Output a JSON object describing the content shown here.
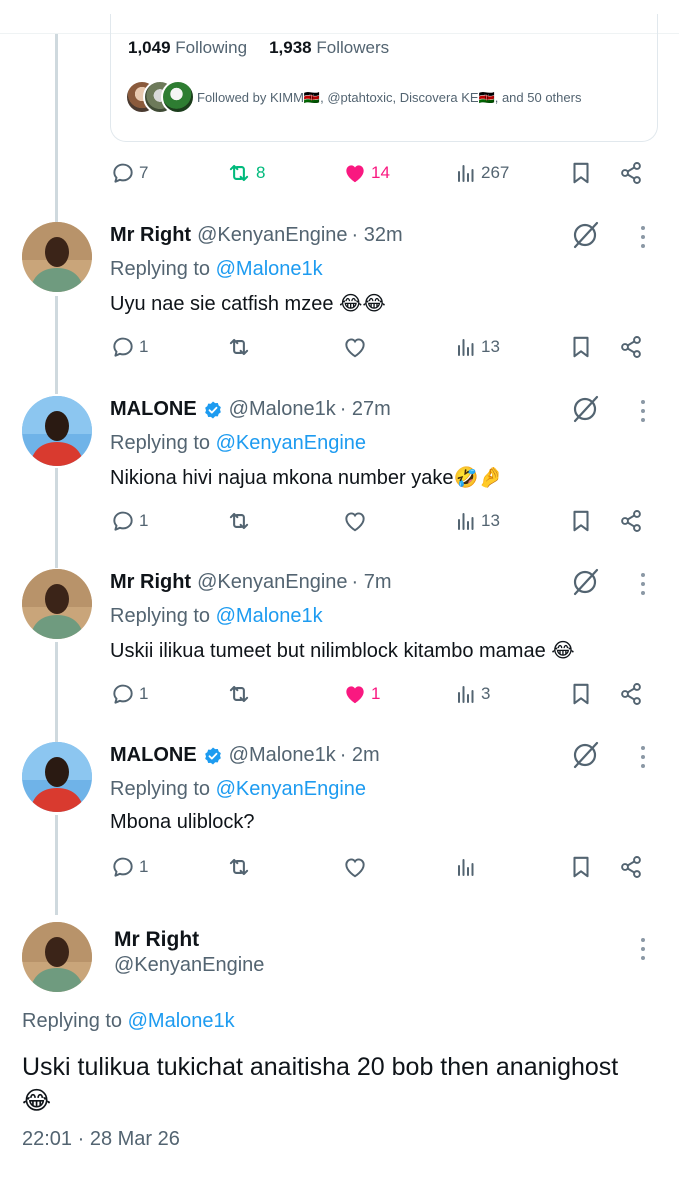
{
  "profile_card": {
    "following_count": "1,049",
    "following_label": "Following",
    "followers_count": "1,938",
    "followers_label": "Followers",
    "followed_by": "Followed by KIMM🇰🇪, @ptahtoxic, Discovera KE🇰🇪, and 50 others"
  },
  "original_actions": {
    "replies": "7",
    "reposts": "8",
    "likes": "14",
    "views": "267"
  },
  "replies": [
    {
      "name": "Mr Right",
      "verified": false,
      "handle": "@KenyanEngine",
      "time": "· 32m",
      "replying_prefix": "Replying to",
      "replying_to": "@Malone1k",
      "text": "Uyu nae sie catfish mzee 😂😂",
      "replies": "1",
      "reposts": "",
      "likes": "",
      "views": "13",
      "liked": false
    },
    {
      "name": "MALONE",
      "verified": true,
      "handle": "@Malone1k",
      "time": "· 27m",
      "replying_prefix": "Replying to",
      "replying_to": "@KenyanEngine",
      "text": "Nikiona hivi najua mkona number yake🤣🤌",
      "replies": "1",
      "reposts": "",
      "likes": "",
      "views": "13",
      "liked": false
    },
    {
      "name": "Mr Right",
      "verified": false,
      "handle": "@KenyanEngine",
      "time": "· 7m",
      "replying_prefix": "Replying to",
      "replying_to": "@Malone1k",
      "text": "Uskii ilikua tumeet but nilimblock kitambo mamae 😂",
      "replies": "1",
      "reposts": "",
      "likes": "1",
      "views": "3",
      "liked": true
    },
    {
      "name": "MALONE",
      "verified": true,
      "handle": "@Malone1k",
      "time": "· 2m",
      "replying_prefix": "Replying to",
      "replying_to": "@KenyanEngine",
      "text": "Mbona uliblock?",
      "replies": "1",
      "reposts": "",
      "likes": "",
      "views": "",
      "liked": false
    }
  ],
  "main_tweet": {
    "name": "Mr Right",
    "handle": "@KenyanEngine",
    "replying_prefix": "Replying to",
    "replying_to": "@Malone1k",
    "text": "Uski tulikua tukichat anaitisha 20 bob then ananighost 😂",
    "timestamp": "22:01 · 28 Mar 26"
  },
  "colors": {
    "like_active": "#f91880",
    "repost_active": "#00ba7c",
    "link": "#1d9bf0",
    "verified": "#1d9bf0",
    "muted_text": "#536471"
  },
  "icons": [
    "reply-icon",
    "repost-icon",
    "like-icon",
    "views-icon",
    "bookmark-icon",
    "share-icon",
    "grok-icon",
    "more-icon",
    "verified-badge-icon"
  ]
}
